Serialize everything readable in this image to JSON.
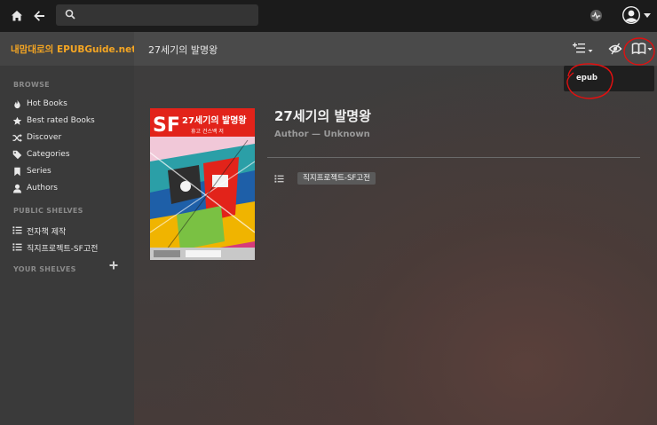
{
  "search": {
    "value": "",
    "placeholder": ""
  },
  "brand": {
    "name": "내맘대로의 EPUBGuide.net"
  },
  "sidebar": {
    "browse_title": "BROWSE",
    "browse_items": [
      {
        "label": "Hot Books",
        "icon": "fire-icon"
      },
      {
        "label": "Best rated Books",
        "icon": "star-icon"
      },
      {
        "label": "Discover",
        "icon": "shuffle-icon"
      },
      {
        "label": "Categories",
        "icon": "tag-icon"
      },
      {
        "label": "Series",
        "icon": "bookmark-icon"
      },
      {
        "label": "Authors",
        "icon": "user-icon"
      }
    ],
    "public_shelves_title": "PUBLIC SHELVES",
    "public_shelves": [
      {
        "label": "전자책 제작"
      },
      {
        "label": "직지프로젝트-SF고전"
      }
    ],
    "your_shelves_title": "YOUR SHELVES"
  },
  "header": {
    "title": "27세기의 발명왕"
  },
  "dropdown": {
    "items": [
      "epub"
    ]
  },
  "book": {
    "title": "27세기의 발명왕",
    "author": "Author — Unknown",
    "shelves": [
      "직지프로젝트-SF고전"
    ],
    "cover": {
      "logo": "SF",
      "cover_title": "27세기의 발명왕",
      "subtitle": "휴고 건스백 저"
    }
  },
  "colors": {
    "topbar": "#1b1b1b",
    "sidebar": "#3a3a3a",
    "brand_accent": "#f5a623",
    "cover_red": "#e2231a",
    "annotation_red": "#e01010"
  }
}
